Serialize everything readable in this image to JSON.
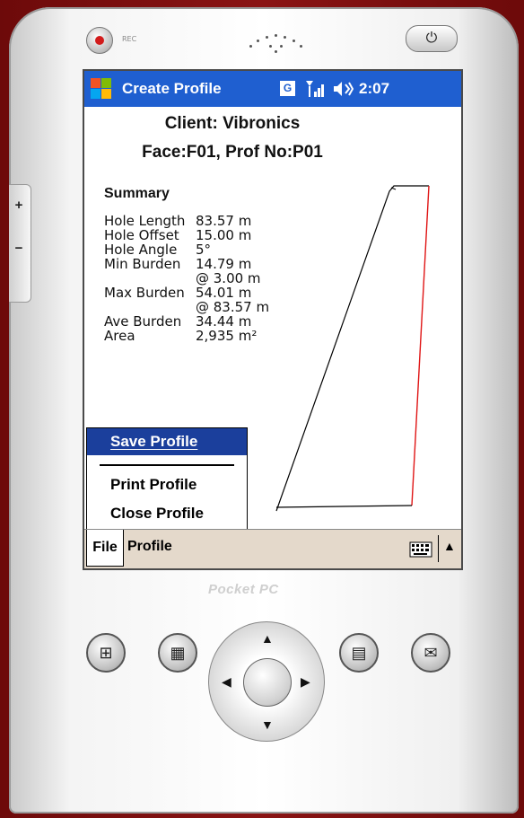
{
  "device": {
    "rec_label": "REC",
    "brand": "Pocket PC",
    "power_icon": "power-icon",
    "side_plus": "+",
    "side_minus": "−"
  },
  "titlebar": {
    "title": "Create Profile",
    "g_label": "G",
    "clock": "2:07",
    "accent": "#1f5fd0"
  },
  "header": {
    "client": "Client: Vibronics",
    "face": "Face:F01, Prof No:P01"
  },
  "summary": {
    "heading": "Summary",
    "rows": [
      {
        "label": "Hole Length",
        "value": "83.57 m"
      },
      {
        "label": "Hole Offset",
        "value": "15.00 m"
      },
      {
        "label": "Hole Angle",
        "value": "5°"
      },
      {
        "label": "Min Burden",
        "value": "14.79 m"
      },
      {
        "label": "",
        "value": " @ 3.00 m"
      },
      {
        "label": "Max Burden",
        "value": "54.01 m"
      },
      {
        "label": "",
        "value": " @ 83.57 m"
      },
      {
        "label": "Ave Burden",
        "value": "34.44 m"
      },
      {
        "label": "Area",
        "value": "2,935 m²"
      }
    ]
  },
  "menu": {
    "items": [
      {
        "label": "Save Profile",
        "selected": true
      },
      {
        "label": "Print Profile",
        "selected": false
      },
      {
        "label": "Close Profile",
        "selected": false
      }
    ]
  },
  "menubar": {
    "file": "File",
    "profile": "Profile"
  },
  "colors": {
    "hole_line": "#e01515",
    "face_line": "#000000",
    "menu_selected": "#1b3f9c"
  }
}
